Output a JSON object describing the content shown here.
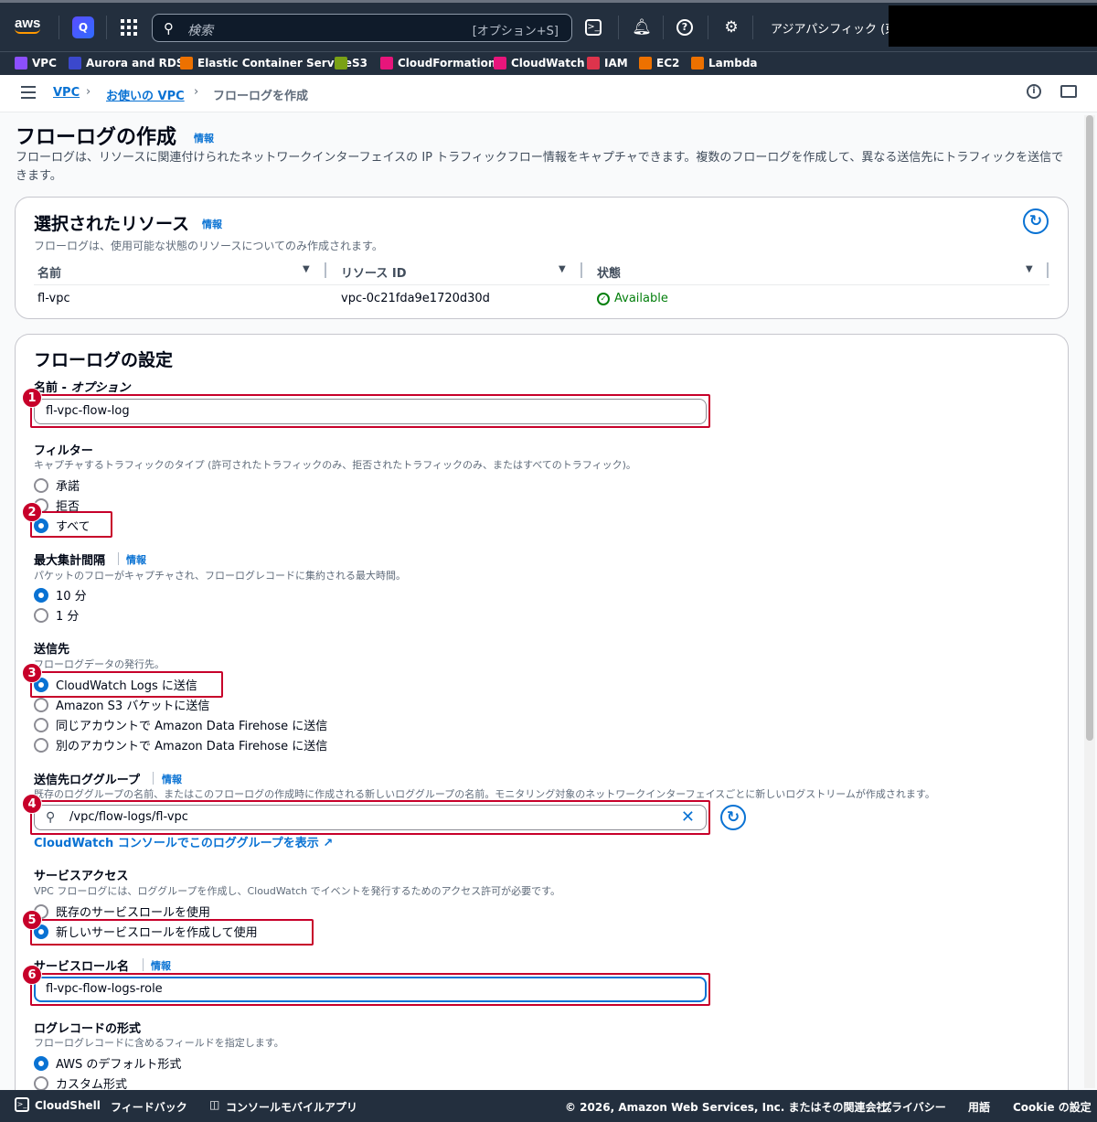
{
  "topnav": {
    "logo_text": "aws",
    "search_placeholder": "検索",
    "search_hint": "[オプション+S]",
    "region": "アジアパシフィック (東京"
  },
  "favorites": [
    {
      "label": "VPC",
      "color": "#8c4fff"
    },
    {
      "label": "Aurora and RDS",
      "color": "#3b48cc"
    },
    {
      "label": "Elastic Container Service",
      "color": "#ed7100"
    },
    {
      "label": "S3",
      "color": "#7aa116"
    },
    {
      "label": "CloudFormation",
      "color": "#e7157b"
    },
    {
      "label": "CloudWatch",
      "color": "#e7157b"
    },
    {
      "label": "IAM",
      "color": "#dd344c"
    },
    {
      "label": "EC2",
      "color": "#ed7100"
    },
    {
      "label": "Lambda",
      "color": "#ed7100"
    }
  ],
  "breadcrumb": {
    "items": [
      "VPC",
      "お使いの VPC",
      "フローログを作成"
    ]
  },
  "page": {
    "title": "フローログの作成",
    "info": "情報",
    "description": "フローログは、リソースに関連付けられたネットワークインターフェイスの IP トラフィックフロー情報をキャプチャできます。複数のフローログを作成して、異なる送信先にトラフィックを送信できます。"
  },
  "resources": {
    "title": "選択されたリソース",
    "info": "情報",
    "description": "フローログは、使用可能な状態のリソースについてのみ作成されます。",
    "columns": [
      "名前",
      "リソース ID",
      "状態"
    ],
    "rows": [
      {
        "name": "fl-vpc",
        "resource_id": "vpc-0c21fda9e1720d30d",
        "status": "Available"
      }
    ]
  },
  "settings": {
    "title": "フローログの設定",
    "name_label": "名前 - ",
    "name_label_opt": "オプション",
    "name_value": "fl-vpc-flow-log",
    "filter_label": "フィルター",
    "filter_help": "キャプチャするトラフィックのタイプ (許可されたトラフィックのみ、拒否されたトラフィックのみ、またはすべてのトラフィック)。",
    "filter_options": [
      "承諾",
      "拒否",
      "すべて"
    ],
    "filter_selected": 2,
    "interval_label": "最大集計間隔",
    "interval_info": "情報",
    "interval_help": "パケットのフローがキャプチャされ、フローログレコードに集約される最大時間。",
    "interval_options": [
      "10 分",
      "1 分"
    ],
    "interval_selected": 0,
    "dest_label": "送信先",
    "dest_help": "フローログデータの発行先。",
    "dest_options": [
      "CloudWatch Logs に送信",
      "Amazon S3 バケットに送信",
      "同じアカウントで Amazon Data Firehose に送信",
      "別のアカウントで Amazon Data Firehose に送信"
    ],
    "dest_selected": 0,
    "loggroup_label": "送信先ロググループ",
    "loggroup_info": "情報",
    "loggroup_help": "既存のロググループの名前、またはこのフローログの作成時に作成される新しいロググループの名前。モニタリング対象のネットワークインターフェイスごとに新しいログストリームが作成されます。",
    "loggroup_value": "/vpc/flow-logs/fl-vpc",
    "loggroup_link": "CloudWatch コンソールでこのロググループを表示",
    "access_label": "サービスアクセス",
    "access_help": "VPC フローログには、ロググループを作成し、CloudWatch でイベントを発行するためのアクセス許可が必要です。",
    "access_options": [
      "既存のサービスロールを使用",
      "新しいサービスロールを作成して使用"
    ],
    "access_selected": 1,
    "role_label": "サービスロール名",
    "role_info": "情報",
    "role_value": "fl-vpc-flow-logs-role",
    "format_label": "ログレコードの形式",
    "format_help": "フローログレコードに含めるフィールドを指定します。",
    "format_options": [
      "AWS のデフォルト形式",
      "カスタム形式"
    ],
    "format_selected": 0
  },
  "annotations": [
    "1",
    "2",
    "3",
    "4",
    "5",
    "6"
  ],
  "footer": {
    "cloudshell": "CloudShell",
    "feedback": "フィードバック",
    "mobile_app": "コンソールモバイルアプリ",
    "copyright": "© 2026, Amazon Web Services, Inc. またはその関連会社。",
    "privacy": "プライバシー",
    "terms": "用語",
    "cookie": "Cookie の設定"
  },
  "colors": {
    "nav_bg": "#232f3e",
    "link": "#0972d3",
    "success": "#037f0c",
    "annotation": "#c7002a"
  }
}
